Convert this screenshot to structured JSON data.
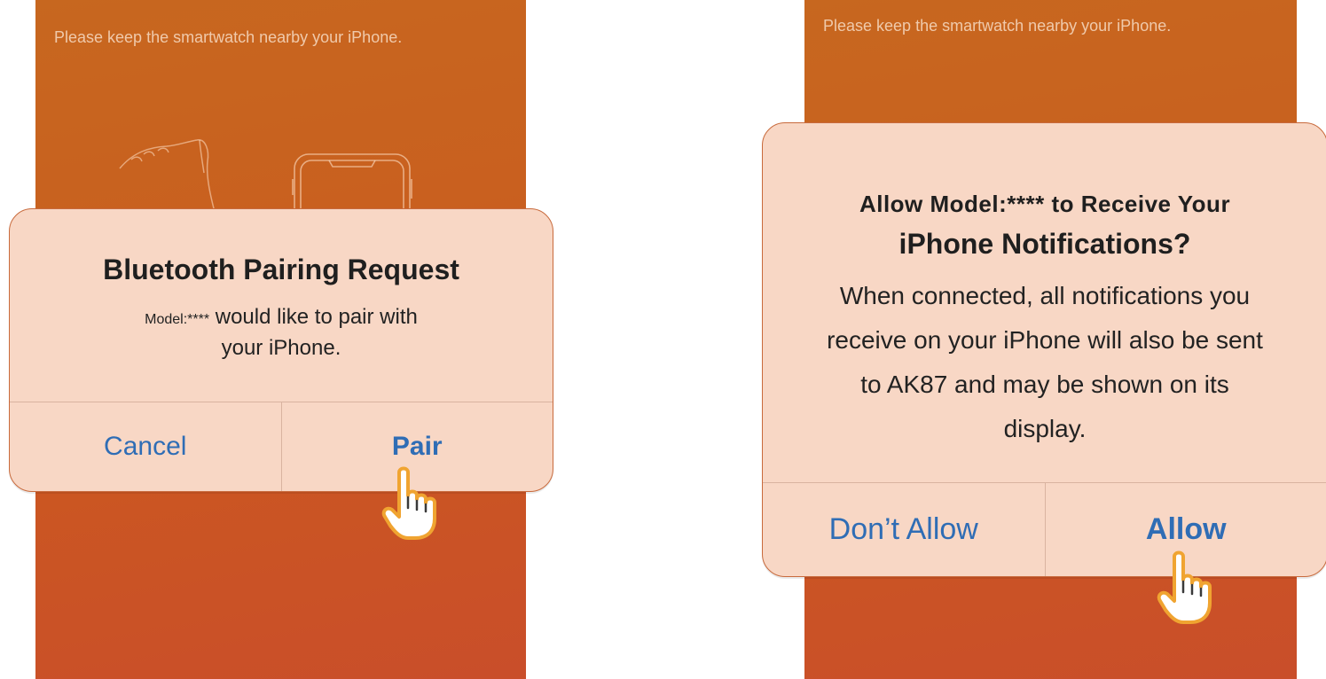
{
  "left_screen": {
    "hint": "Please keep the smartwatch nearby your iPhone.",
    "dialog": {
      "title": "Bluetooth Pairing Request",
      "message_model": "Model:****",
      "message_rest": " would like to pair with",
      "message_line2": "your iPhone.",
      "cancel_label": "Cancel",
      "pair_label": "Pair"
    }
  },
  "right_screen": {
    "hint": "Please keep the smartwatch nearby your iPhone.",
    "dialog": {
      "title_line1": "Allow Model:**** to Receive Your",
      "title_line2": "iPhone Notifications?",
      "message_lines": [
        "When connected, all notifications you",
        "receive on your iPhone will also be sent",
        "to AK87 and may be shown on its",
        "display."
      ],
      "dont_allow_label": "Don’t Allow",
      "allow_label": "Allow"
    }
  },
  "colors": {
    "background_orange": "#c9601f",
    "dialog_fill": "#f8d7c5",
    "button_blue": "#2f6db5",
    "hand_fill": "#ffffff",
    "hand_outline": "#f0a431"
  },
  "icons": [
    "watch-hand-illustration",
    "phone-outline-illustration",
    "tap-hand-icon"
  ]
}
